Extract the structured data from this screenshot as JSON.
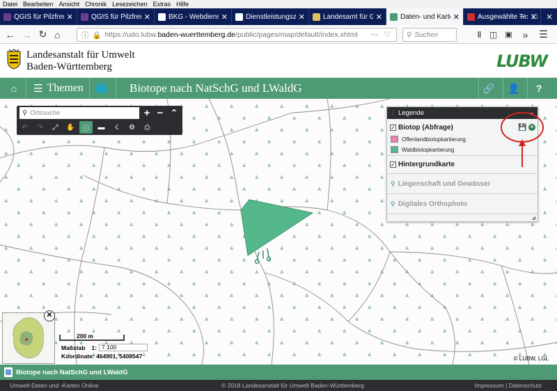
{
  "browser": {
    "menu": [
      "Datei",
      "Bearbeiten",
      "Ansicht",
      "Chronik",
      "Lesezeichen",
      "Extras",
      "Hilfe"
    ],
    "tabs": [
      {
        "label": "QGIS für Pilzfreunde",
        "favicon_color": "#6a3d8f"
      },
      {
        "label": "QGIS für Pilzfreunde",
        "favicon_color": "#6a3d8f"
      },
      {
        "label": "BKG - Webdienste",
        "favicon_color": "#ffffff"
      },
      {
        "label": "Dienstleistungszentr",
        "favicon_color": "#ffffff"
      },
      {
        "label": "Landesamt für Geo",
        "favicon_color": "#e0c060"
      },
      {
        "label": "Daten- und Karten",
        "favicon_color": "#4e9a74"
      },
      {
        "label": "Ausgewählte Texte",
        "favicon_color": "#d03030"
      }
    ],
    "active_tab": 5,
    "url_prefix": "https://udo.lubw.",
    "url_host": "baden-wuerttemberg.de",
    "url_path": "/public/pages/map/default/index.xhtml",
    "search_placeholder": "Suchen"
  },
  "site": {
    "org_line1": "Landesanstalt für Umwelt",
    "org_line2": "Baden-Württemberg",
    "logo_text": "LUBW",
    "themen_label": "Themen",
    "page_title": "Biotope nach NatSchG und LWaldG"
  },
  "maptools": {
    "search_placeholder": "Ortssuche"
  },
  "legend": {
    "title": "Legende",
    "layer1_title": "Biotop (Abfrage)",
    "items": [
      {
        "label": "Offenlandbiotopkartierung",
        "color": "#f080b0"
      },
      {
        "label": "Waldbiotopkartierung",
        "color": "#55b88c"
      }
    ],
    "layer2_title": "Hintergrundkarte",
    "sublayers": [
      "Liegenschaft und Gewässer",
      "Digitales Orthophoto"
    ]
  },
  "map": {
    "scale_label": "200 m",
    "massstab_label": "Maßstab",
    "massstab_prefix": "1:",
    "massstab_value": "7.100",
    "coord_label": "Koordinate:",
    "coord_value": "464901, 5408547",
    "copyright": "© LUBW, LGL",
    "polygon_color": "#55b88c"
  },
  "bottom": {
    "tab_label": "Biotope nach NatSchG und LWaldG",
    "footer_left": "Umwelt-Daten und -Karten Online",
    "footer_center": "© 2018 Landesanstalt für Umwelt Baden-Württemberg",
    "footer_right": "Impressum | Datenschutz"
  },
  "annotation_color": "#d42020"
}
